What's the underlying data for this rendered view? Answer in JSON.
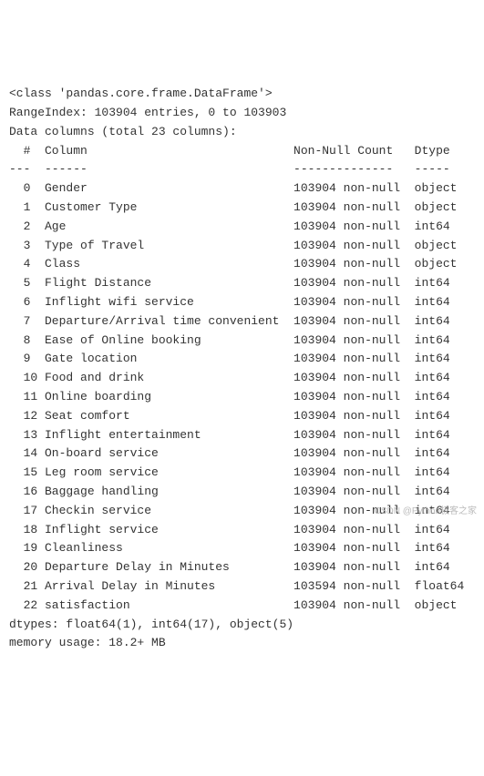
{
  "header": {
    "class_line": "<class 'pandas.core.frame.DataFrame'>",
    "range_index": "RangeIndex: 103904 entries, 0 to 103903",
    "data_columns": "Data columns (total 23 columns):"
  },
  "table_header": {
    "idx": " #",
    "col": "Column",
    "nonnull": "Non-Null Count",
    "dtype": "Dtype"
  },
  "separator": {
    "idx": "---",
    "col": "------",
    "nonnull": "--------------",
    "dtype": "-----"
  },
  "columns": [
    {
      "idx": " 0",
      "name": "Gender",
      "nonnull": "103904 non-null",
      "dtype": "object"
    },
    {
      "idx": " 1",
      "name": "Customer Type",
      "nonnull": "103904 non-null",
      "dtype": "object"
    },
    {
      "idx": " 2",
      "name": "Age",
      "nonnull": "103904 non-null",
      "dtype": "int64"
    },
    {
      "idx": " 3",
      "name": "Type of Travel",
      "nonnull": "103904 non-null",
      "dtype": "object"
    },
    {
      "idx": " 4",
      "name": "Class",
      "nonnull": "103904 non-null",
      "dtype": "object"
    },
    {
      "idx": " 5",
      "name": "Flight Distance",
      "nonnull": "103904 non-null",
      "dtype": "int64"
    },
    {
      "idx": " 6",
      "name": "Inflight wifi service",
      "nonnull": "103904 non-null",
      "dtype": "int64"
    },
    {
      "idx": " 7",
      "name": "Departure/Arrival time convenient",
      "nonnull": "103904 non-null",
      "dtype": "int64"
    },
    {
      "idx": " 8",
      "name": "Ease of Online booking",
      "nonnull": "103904 non-null",
      "dtype": "int64"
    },
    {
      "idx": " 9",
      "name": "Gate location",
      "nonnull": "103904 non-null",
      "dtype": "int64"
    },
    {
      "idx": " 10",
      "name": "Food and drink",
      "nonnull": "103904 non-null",
      "dtype": "int64"
    },
    {
      "idx": " 11",
      "name": "Online boarding",
      "nonnull": "103904 non-null",
      "dtype": "int64"
    },
    {
      "idx": " 12",
      "name": "Seat comfort",
      "nonnull": "103904 non-null",
      "dtype": "int64"
    },
    {
      "idx": " 13",
      "name": "Inflight entertainment",
      "nonnull": "103904 non-null",
      "dtype": "int64"
    },
    {
      "idx": " 14",
      "name": "On-board service",
      "nonnull": "103904 non-null",
      "dtype": "int64"
    },
    {
      "idx": " 15",
      "name": "Leg room service",
      "nonnull": "103904 non-null",
      "dtype": "int64"
    },
    {
      "idx": " 16",
      "name": "Baggage handling",
      "nonnull": "103904 non-null",
      "dtype": "int64"
    },
    {
      "idx": " 17",
      "name": "Checkin service",
      "nonnull": "103904 non-null",
      "dtype": "int64"
    },
    {
      "idx": " 18",
      "name": "Inflight service",
      "nonnull": "103904 non-null",
      "dtype": "int64"
    },
    {
      "idx": " 19",
      "name": "Cleanliness",
      "nonnull": "103904 non-null",
      "dtype": "int64"
    },
    {
      "idx": " 20",
      "name": "Departure Delay in Minutes",
      "nonnull": "103904 non-null",
      "dtype": "int64"
    },
    {
      "idx": " 21",
      "name": "Arrival Delay in Minutes",
      "nonnull": "103594 non-null",
      "dtype": "float64"
    },
    {
      "idx": " 22",
      "name": "satisfaction",
      "nonnull": "103904 non-null",
      "dtype": "object"
    }
  ],
  "footer": {
    "dtypes": "dtypes: float64(1), int64(17), object(5)",
    "memory": "memory usage: 18.2+ MB"
  },
  "watermark": "CSDN @Python极客之家"
}
